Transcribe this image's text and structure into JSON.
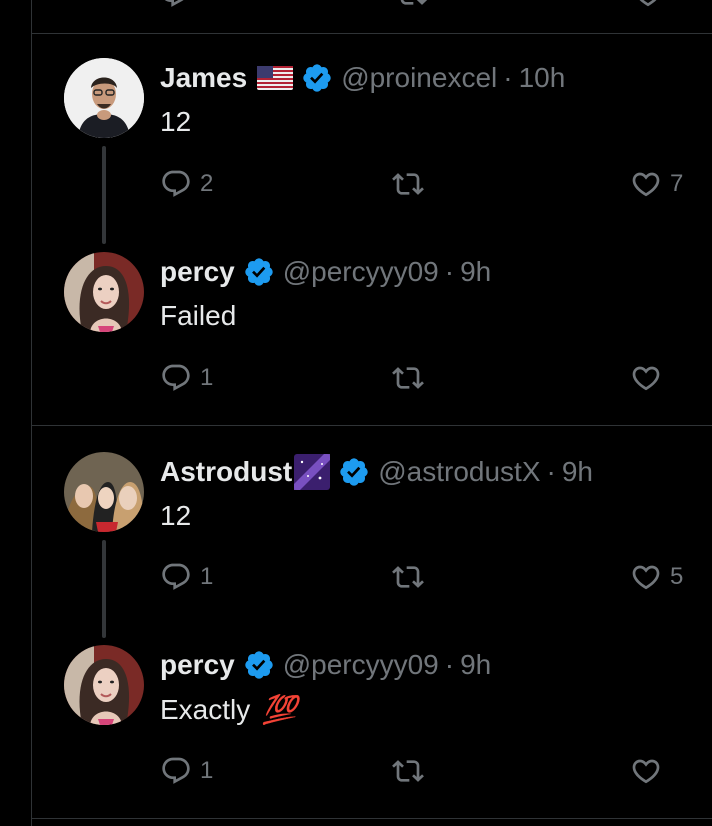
{
  "tweets": [
    {
      "name": "James",
      "handle": "@proinexcel",
      "sep": "·",
      "time": "10h",
      "text": "12",
      "replies": "2",
      "retweets": "",
      "likes": "7",
      "flag": "us-flag",
      "verified": true
    },
    {
      "name": "percy",
      "handle": "@percyyy09",
      "sep": "·",
      "time": "9h",
      "text": "Failed",
      "replies": "1",
      "retweets": "",
      "likes": "",
      "verified": true
    },
    {
      "name": "Astrodust",
      "handle": "@astrodustX",
      "sep": "·",
      "time": "9h",
      "text": "12",
      "replies": "1",
      "retweets": "",
      "likes": "5",
      "verified": true
    },
    {
      "name": "percy",
      "handle": "@percyyy09",
      "sep": "·",
      "time": "9h",
      "text": "Exactly",
      "text_emoji": "💯",
      "replies": "1",
      "retweets": "",
      "likes": "",
      "verified": true
    }
  ],
  "colors": {
    "background": "#000000",
    "border": "#2f3336",
    "text": "#e7e9ea",
    "muted": "#71767b",
    "verified": "#1d9bf0"
  },
  "icons": [
    "reply-icon",
    "retweet-icon",
    "like-icon",
    "verified-badge-icon"
  ]
}
